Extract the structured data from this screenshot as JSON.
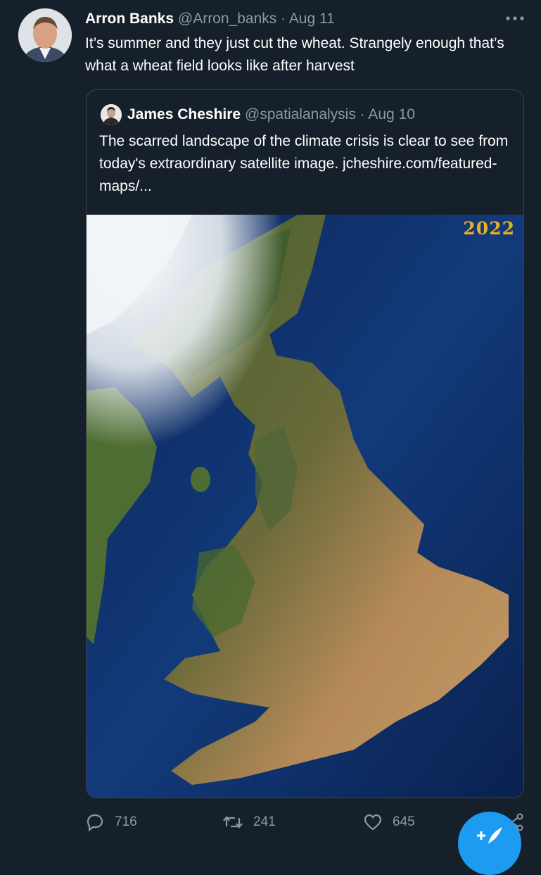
{
  "tweet": {
    "author_name": "Arron Banks",
    "author_handle": "@Arron_banks",
    "separator": "·",
    "date": "Aug 11",
    "text": "It’s summer and they just cut the wheat. Strangely enough that’s what a wheat field looks like after harvest",
    "more_icon": "more-horizontal-icon"
  },
  "quoted_tweet": {
    "author_name": "James Cheshire",
    "author_handle": "@spatialanalysis",
    "separator": "·",
    "date": "Aug 10",
    "text": "The scarred landscape of the climate crisis is clear to see from today's extraordinary satellite image.",
    "link_text": "jcheshire.com/featured-maps/...",
    "image_label": "2022"
  },
  "actions": {
    "reply": {
      "icon": "reply-icon",
      "count": "716"
    },
    "retweet": {
      "icon": "retweet-icon",
      "count": "241"
    },
    "like": {
      "icon": "heart-icon",
      "count": "645"
    },
    "share": {
      "icon": "share-icon"
    }
  },
  "compose_fab": {
    "icon": "compose-tweet-icon"
  },
  "colors": {
    "background": "#15202b",
    "border": "#38444d",
    "muted_text": "#8b98a5",
    "accent": "#1d9bf0",
    "year_label": "#e6b020"
  }
}
